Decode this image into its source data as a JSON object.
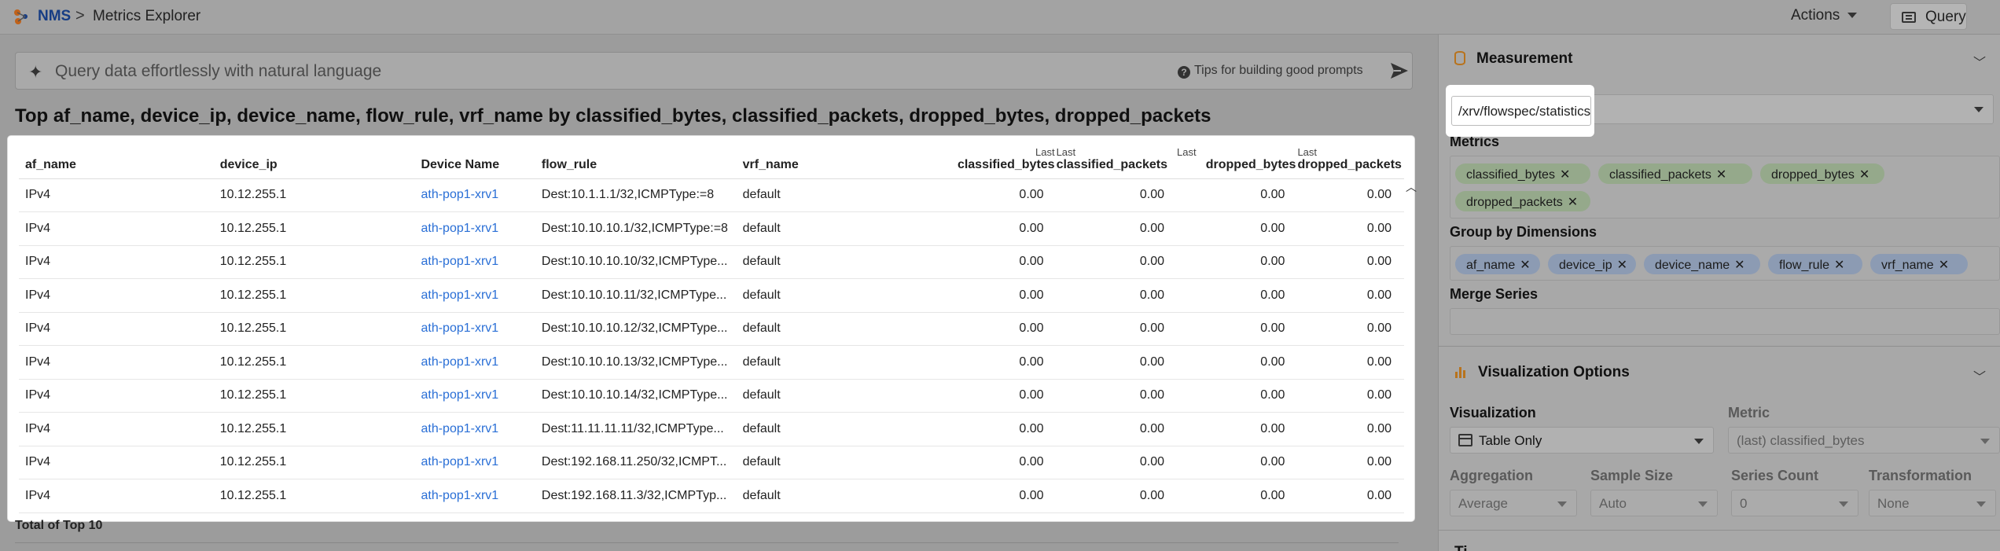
{
  "header": {
    "breadcrumb_root": "NMS",
    "breadcrumb_sep": ">",
    "page_title": "Metrics Explorer",
    "actions_label": "Actions",
    "query_label": "Query"
  },
  "nl_query": {
    "placeholder": "Query data effortlessly with natural language",
    "tips_label": "Tips for building good prompts"
  },
  "query_title": "Top af_name, device_ip, device_name, flow_rule, vrf_name by classified_bytes, classified_packets, dropped_bytes, dropped_packets",
  "table": {
    "headers": {
      "af_name": "af_name",
      "device_ip": "device_ip",
      "device_name": "Device Name",
      "flow_rule": "flow_rule",
      "vrf_name": "vrf_name",
      "last": "Last",
      "classified_bytes": "classified_bytes",
      "classified_packets": "classified_packets",
      "dropped_bytes": "dropped_bytes",
      "dropped_packets": "dropped_packets"
    },
    "rows": [
      {
        "af": "IPv4",
        "ip": "10.12.255.1",
        "dev": "ath-pop1-xrv1",
        "flow": "Dest:10.1.1.1/32,ICMPType:=8",
        "vrf": "default",
        "cb": "0.00",
        "cp": "0.00",
        "db": "0.00",
        "dp": "0.00"
      },
      {
        "af": "IPv4",
        "ip": "10.12.255.1",
        "dev": "ath-pop1-xrv1",
        "flow": "Dest:10.10.10.1/32,ICMPType:=8",
        "vrf": "default",
        "cb": "0.00",
        "cp": "0.00",
        "db": "0.00",
        "dp": "0.00"
      },
      {
        "af": "IPv4",
        "ip": "10.12.255.1",
        "dev": "ath-pop1-xrv1",
        "flow": "Dest:10.10.10.10/32,ICMPType...",
        "vrf": "default",
        "cb": "0.00",
        "cp": "0.00",
        "db": "0.00",
        "dp": "0.00"
      },
      {
        "af": "IPv4",
        "ip": "10.12.255.1",
        "dev": "ath-pop1-xrv1",
        "flow": "Dest:10.10.10.11/32,ICMPType...",
        "vrf": "default",
        "cb": "0.00",
        "cp": "0.00",
        "db": "0.00",
        "dp": "0.00"
      },
      {
        "af": "IPv4",
        "ip": "10.12.255.1",
        "dev": "ath-pop1-xrv1",
        "flow": "Dest:10.10.10.12/32,ICMPType...",
        "vrf": "default",
        "cb": "0.00",
        "cp": "0.00",
        "db": "0.00",
        "dp": "0.00"
      },
      {
        "af": "IPv4",
        "ip": "10.12.255.1",
        "dev": "ath-pop1-xrv1",
        "flow": "Dest:10.10.10.13/32,ICMPType...",
        "vrf": "default",
        "cb": "0.00",
        "cp": "0.00",
        "db": "0.00",
        "dp": "0.00"
      },
      {
        "af": "IPv4",
        "ip": "10.12.255.1",
        "dev": "ath-pop1-xrv1",
        "flow": "Dest:10.10.10.14/32,ICMPType...",
        "vrf": "default",
        "cb": "0.00",
        "cp": "0.00",
        "db": "0.00",
        "dp": "0.00"
      },
      {
        "af": "IPv4",
        "ip": "10.12.255.1",
        "dev": "ath-pop1-xrv1",
        "flow": "Dest:11.11.11.11/32,ICMPType...",
        "vrf": "default",
        "cb": "0.00",
        "cp": "0.00",
        "db": "0.00",
        "dp": "0.00"
      },
      {
        "af": "IPv4",
        "ip": "10.12.255.1",
        "dev": "ath-pop1-xrv1",
        "flow": "Dest:192.168.11.250/32,ICMPT...",
        "vrf": "default",
        "cb": "0.00",
        "cp": "0.00",
        "db": "0.00",
        "dp": "0.00"
      },
      {
        "af": "IPv4",
        "ip": "10.12.255.1",
        "dev": "ath-pop1-xrv1",
        "flow": "Dest:192.168.11.3/32,ICMPTyp...",
        "vrf": "default",
        "cb": "0.00",
        "cp": "0.00",
        "db": "0.00",
        "dp": "0.00"
      }
    ],
    "total_label": "Total of Top 10"
  },
  "panel": {
    "measurement_title": "Measurement",
    "measurement_value": "/xrv/flowspec/statistics",
    "metrics_label": "Metrics",
    "metrics": [
      "classified_bytes",
      "classified_packets",
      "dropped_bytes",
      "dropped_packets"
    ],
    "group_by_label": "Group by Dimensions",
    "group_by": [
      "af_name",
      "device_ip",
      "device_name",
      "flow_rule",
      "vrf_name"
    ],
    "merge_series_label": "Merge Series",
    "viz_options_title": "Visualization Options",
    "visualization_label": "Visualization",
    "visualization_value": "Table Only",
    "metric_label": "Metric",
    "metric_value": "(last) classified_bytes",
    "aggregation_label": "Aggregation",
    "aggregation_value": "Average",
    "sample_size_label": "Sample Size",
    "sample_size_value": "Auto",
    "series_count_label": "Series Count",
    "series_count_value": "0",
    "transformation_label": "Transformation",
    "transformation_value": "None",
    "next_section_title": "Ti..."
  },
  "colors": {
    "accent_link": "#2a6fd6",
    "brand": "#173d84",
    "metric_chip": "#95a98b",
    "dimension_chip": "#8c9bb3",
    "section_icon": "#b8731d"
  }
}
